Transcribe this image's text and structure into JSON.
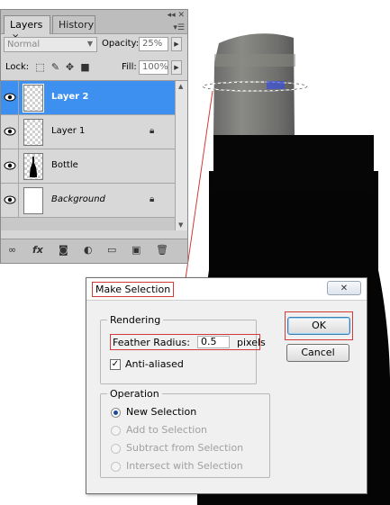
{
  "layers_panel": {
    "tabs": [
      {
        "label": "Layers",
        "close": "×"
      },
      {
        "label": "History"
      }
    ],
    "blend_mode": "Normal",
    "opacity_label": "Opacity:",
    "opacity_value": "25%",
    "lock_label": "Lock:",
    "fill_label": "Fill:",
    "fill_value": "100%",
    "layers": [
      {
        "name": "Layer 2"
      },
      {
        "name": "Layer 1"
      },
      {
        "name": "Bottle"
      },
      {
        "name": "Background"
      }
    ],
    "bottom_icons": [
      "link-icon",
      "fx-icon",
      "mask-icon",
      "adjustment-icon",
      "folder-icon",
      "new-layer-icon",
      "trash-icon"
    ],
    "fx_label": "fx"
  },
  "dialog": {
    "title": "Make Selection",
    "close_label": "✕",
    "rendering": {
      "legend": "Rendering",
      "feather_label": "Feather Radius:",
      "feather_value": "0.5",
      "feather_unit": "pixels",
      "antialiased_label": "Anti-aliased",
      "antialiased_checked": true
    },
    "operation": {
      "legend": "Operation",
      "options": [
        {
          "label": "New Selection"
        },
        {
          "label": "Add to Selection"
        },
        {
          "label": "Subtract from Selection"
        },
        {
          "label": "Intersect with Selection"
        }
      ]
    },
    "ok_label": "OK",
    "cancel_label": "Cancel"
  },
  "colors": {
    "selected_layer": "#3d8ff0",
    "highlight_border": "#d23a3a",
    "bottle_body": "#050505",
    "bottle_cap": "#7c7c7c"
  }
}
